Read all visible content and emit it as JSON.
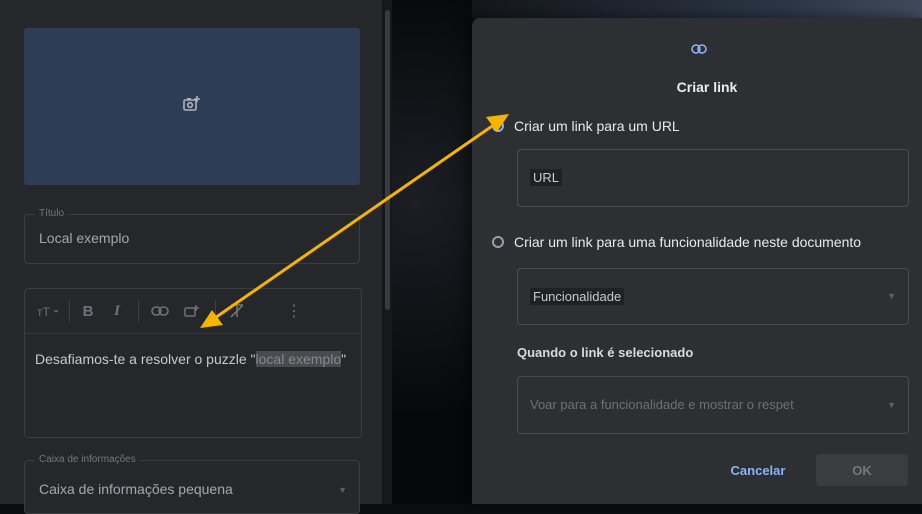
{
  "editor": {
    "title_legend": "Título",
    "title_value": "Local exemplo",
    "description_prefix": "Desafiamos-te a resolver o puzzle \"",
    "description_highlight": "local exemplo",
    "description_suffix": "\"",
    "infobox_legend": "Caixa de informações",
    "infobox_value": "Caixa de informações pequena",
    "toolbar_icons": [
      "text-size-icon",
      "bold-icon",
      "italic-icon",
      "link-icon",
      "insert-link-icon",
      "clear-formatting-icon",
      "more-icon"
    ]
  },
  "dialog": {
    "title": "Criar link",
    "option_url": "Criar um link para um URL",
    "url_placeholder": "URL",
    "option_feature": "Criar um link para uma funcionalidade neste documento",
    "feature_select_value": "Funcionalidade",
    "when_selected_label": "Quando o link é selecionado",
    "action_select_value": "Voar para a funcionalidade e mostrar o respet",
    "cancel_label": "Cancelar",
    "ok_label": "OK",
    "selected_option": "url"
  },
  "colors": {
    "accent": "#8ab4f8",
    "annotation_arrow": "#f4b400",
    "dialog_bg": "#2e2f32",
    "panel_bg": "#26272a",
    "image_placeholder_bg": "#2f3c55"
  }
}
